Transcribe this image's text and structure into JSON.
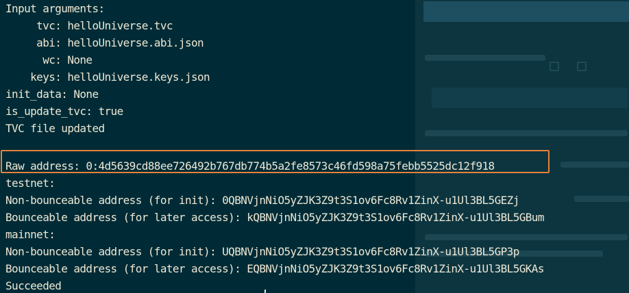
{
  "terminal": {
    "lines": [
      "Input arguments:",
      "     tvc: helloUniverse.tvc",
      "     abi: helloUniverse.abi.json",
      "      wc: None",
      "    keys: helloUniverse.keys.json",
      "init_data: None",
      "is_update_tvc: true",
      "TVC file updated",
      "",
      "Raw address: 0:4d5639cd88ee726492b767db774b5a2fe8573c46fd598a75febb5525dc12f918",
      "testnet:",
      "Non-bounceable address (for init): 0QBNVjnNiO5yZJK3Z9t3S1ov6Fc8Rv1ZinX-u1Ul3BL5GEZj",
      "Bounceable address (for later access): kQBNVjnNiO5yZJK3Z9t3S1ov6Fc8Rv1ZinX-u1Ul3BL5GBum",
      "mainnet:",
      "Non-bounceable address (for init): UQBNVjnNiO5yZJK3Z9t3S1ov6Fc8Rv1ZinX-u1Ul3BL5GP3p",
      "Bounceable address (for later access): EQBNVjnNiO5yZJK3Z9t3S1ov6Fc8Rv1ZinX-u1Ul3BL5GKAs",
      "Succeeded"
    ]
  },
  "colors": {
    "terminal_background": "#002b36",
    "terminal_text": "#eee8d5",
    "highlight_border": "#e8823a"
  }
}
